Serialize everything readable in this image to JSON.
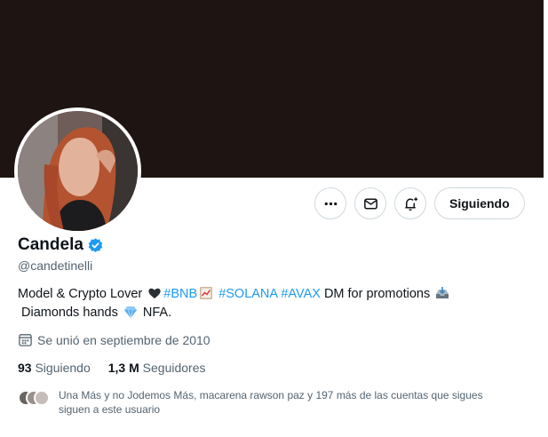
{
  "profile": {
    "display_name": "Candela",
    "handle": "@candetinelli",
    "verified": true
  },
  "bio": {
    "part1": "Model & Crypto Lover ",
    "heart_emoji": "black-heart",
    "tag_bnb": "#BNB",
    "chart_emoji": "chart-emoji",
    "tag_solana": "#SOLANA",
    "tag_avax": "#AVAX",
    "part2": " DM for promotions ",
    "inbox_emoji": "inbox-tray-emoji",
    "line2_prefix": "Diamonds hands ",
    "gem_emoji": "gem-stone",
    "line2_suffix": " NFA."
  },
  "joined": {
    "icon": "calendar-icon",
    "text": "Se unió en septiembre de 2010"
  },
  "stats": {
    "following_count": "93",
    "following_label": "Siguiendo",
    "followers_count": "1,3 M",
    "followers_label": "Seguidores"
  },
  "followed_by": {
    "text": "Una Más y no Jodemos Más, macarena rawson paz y 197 más de las cuentas que sigues siguen a este usuario"
  },
  "actions": {
    "more_icon": "more-icon",
    "message_icon": "mail-icon",
    "notify_icon": "bell-plus-icon",
    "follow_label": "Siguiendo"
  },
  "colors": {
    "banner": "#1e1411",
    "accent": "#1d9bf0",
    "secondary_text": "#536471",
    "border": "#cfd9de"
  }
}
